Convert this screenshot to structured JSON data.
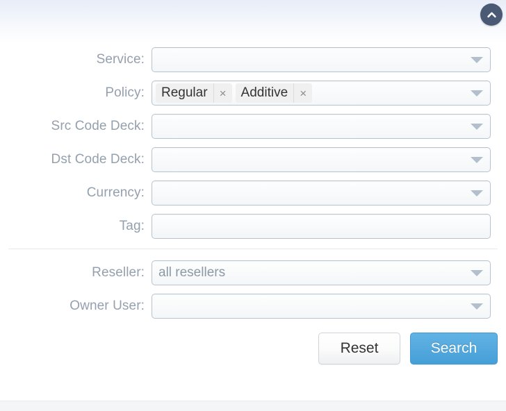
{
  "panel": {
    "collapse_icon": "chevron-up-icon",
    "accent_color": "#4a9fd8",
    "collapse_button_color": "#4a5a75",
    "label_color": "#95a0ae",
    "field_border_color": "#b9c2cf"
  },
  "fields": [
    {
      "name": "service",
      "label": "Service:",
      "type": "select",
      "value": "",
      "caret_icon": "chevron-down-icon"
    },
    {
      "name": "policy",
      "label": "Policy:",
      "type": "multiselect",
      "value": "",
      "caret_icon": "chevron-down-icon",
      "tokens": [
        {
          "label": "Regular",
          "remove_icon": "close-icon",
          "remove_glyph": "×"
        },
        {
          "label": "Additive",
          "remove_icon": "close-icon",
          "remove_glyph": "×"
        }
      ]
    },
    {
      "name": "src-code-deck",
      "label": "Src Code Deck:",
      "type": "select",
      "value": "",
      "caret_icon": "chevron-down-icon"
    },
    {
      "name": "dst-code-deck",
      "label": "Dst Code Deck:",
      "type": "select",
      "value": "",
      "caret_icon": "chevron-down-icon"
    },
    {
      "name": "currency",
      "label": "Currency:",
      "type": "select",
      "value": "",
      "caret_icon": "chevron-down-icon"
    },
    {
      "name": "tag",
      "label": "Tag:",
      "type": "text",
      "value": "",
      "placeholder": ""
    }
  ],
  "fields_secondary": [
    {
      "name": "reseller",
      "label": "Reseller:",
      "type": "select",
      "value": "all resellers",
      "caret_icon": "chevron-down-icon"
    },
    {
      "name": "owner-user",
      "label": "Owner User:",
      "type": "select",
      "value": "",
      "caret_icon": "chevron-down-icon"
    }
  ],
  "actions": {
    "reset_label": "Reset",
    "search_label": "Search"
  }
}
